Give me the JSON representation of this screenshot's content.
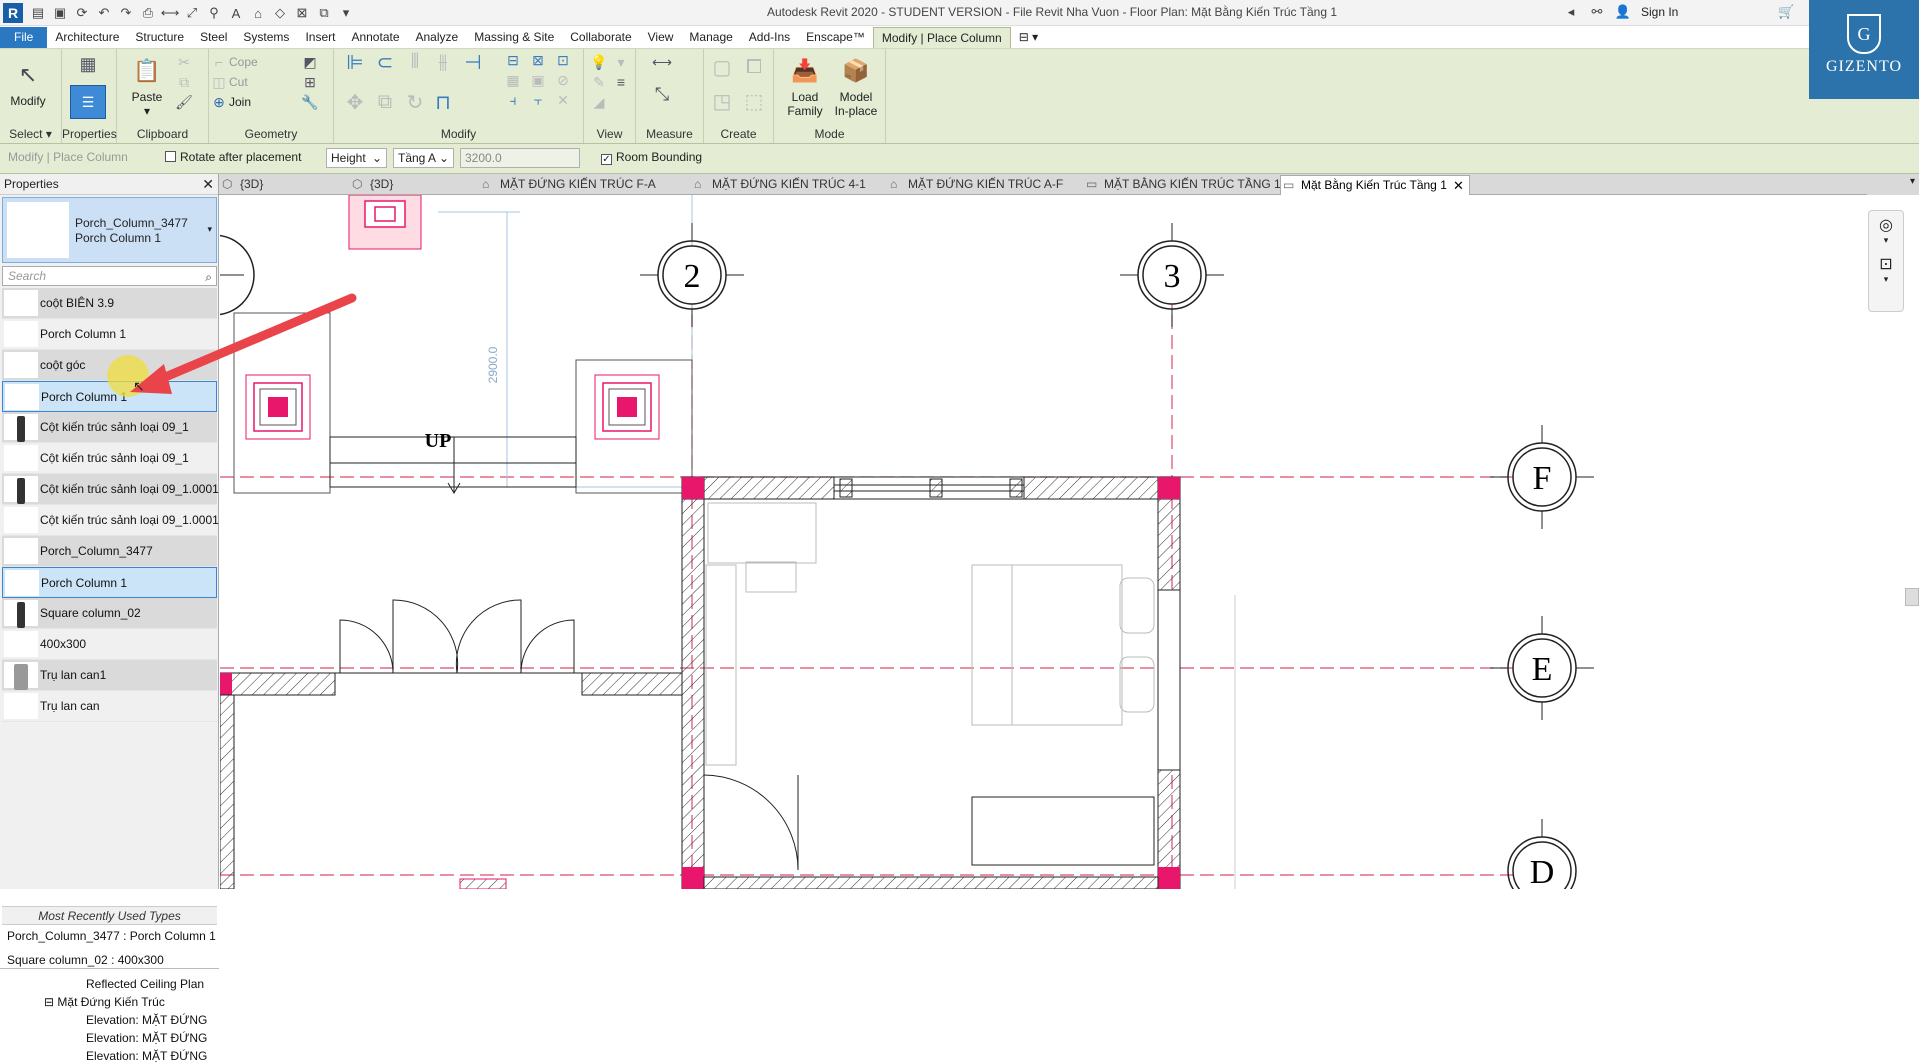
{
  "app": {
    "title": "Autodesk Revit 2020 - STUDENT VERSION - File Revit Nha Vuon - Floor Plan: Mặt Bằng Kiến Trúc Tầng 1",
    "sign_in": "Sign In",
    "logo": "R"
  },
  "menu": [
    "File",
    "Architecture",
    "Structure",
    "Steel",
    "Systems",
    "Insert",
    "Annotate",
    "Analyze",
    "Massing & Site",
    "Collaborate",
    "View",
    "Manage",
    "Add-Ins",
    "Enscape™",
    "Modify | Place Column"
  ],
  "ribbon": {
    "select_label": "Select",
    "properties_label": "Properties",
    "clipboard_label": "Clipboard",
    "geometry_label": "Geometry",
    "modify_label": "Modify",
    "view_label": "View",
    "measure_label": "Measure",
    "create_label": "Create",
    "mode_label": "Mode",
    "modify_btn": "Modify",
    "paste_btn": "Paste",
    "cope": "Cope",
    "cut": "Cut",
    "join": "Join",
    "load_family_1": "Load",
    "load_family_2": "Family",
    "model_inplace_1": "Model",
    "model_inplace_2": "In-place"
  },
  "options": {
    "context": "Modify | Place Column",
    "rotate": "Rotate after placement",
    "height_mode": "Height",
    "level": "Tầng A",
    "height_value": "3200.0",
    "room_bounding": "Room Bounding"
  },
  "view_tabs": [
    "{3D}",
    "{3D}",
    "MẶT ĐỨNG KIẾN TRÚC F-A",
    "MẶT ĐỨNG KIẾN TRÚC 4-1",
    "MẶT ĐỨNG KIẾN TRÚC A-F",
    "MẶT BẰNG KIẾN TRÚC TẦNG 1",
    "Mặt Bằng Kiến Trúc Tầng 1"
  ],
  "properties": {
    "header": "Properties",
    "type_family": "Porch_Column_3477",
    "type_name": "Porch Column 1",
    "search_placeholder": "Search",
    "types": [
      {
        "label": "coột BIÊN 3.9",
        "shaded": true,
        "glyph": "none"
      },
      {
        "label": "Porch Column 1",
        "shaded": false,
        "glyph": "none"
      },
      {
        "label": "coột góc",
        "shaded": true,
        "glyph": "none"
      },
      {
        "label": "Porch Column 1",
        "shaded": false,
        "glyph": "none",
        "selected": true
      },
      {
        "label": "Cột kiến trúc sảnh loại 09_1",
        "shaded": true,
        "glyph": "dark"
      },
      {
        "label": "Cột kiến trúc sảnh loại 09_1",
        "shaded": false,
        "glyph": "none"
      },
      {
        "label": "Cột kiến trúc sảnh loại 09_1.0001",
        "shaded": true,
        "glyph": "dark"
      },
      {
        "label": "Cột kiến trúc sảnh loại 09_1.0001",
        "shaded": false,
        "glyph": "none"
      },
      {
        "label": "Porch_Column_3477",
        "shaded": true,
        "glyph": "none"
      },
      {
        "label": "Porch Column 1",
        "shaded": false,
        "glyph": "none",
        "selected": true
      },
      {
        "label": "Square column_02",
        "shaded": true,
        "glyph": "dark"
      },
      {
        "label": "400x300",
        "shaded": false,
        "glyph": "none"
      },
      {
        "label": "Trụ lan can1",
        "shaded": true,
        "glyph": "light"
      },
      {
        "label": "Trụ lan can",
        "shaded": false,
        "glyph": "none"
      }
    ],
    "mru_header": "Most Recently Used Types",
    "mru": [
      "Porch_Column_3477 : Porch Column 1",
      "Square column_02 : 400x300"
    ]
  },
  "browser": {
    "items": [
      "Reflected Ceiling Plan",
      "Mặt Đứng Kiến Trúc",
      "Elevation: MẶT ĐỨNG",
      "Elevation: MẶT ĐỨNG",
      "Elevation: MẶT ĐỨNG"
    ]
  },
  "canvas": {
    "grid_2": "2",
    "grid_3": "3",
    "grid_F": "F",
    "grid_E": "E",
    "grid_D": "D",
    "stair_up": "UP",
    "dim_text": "2900.0"
  },
  "logo_text": "GIZENTO",
  "logo_mark": "G",
  "colors": {
    "ribbon": "#e4ecd4",
    "accent": "#2b78c2",
    "column_red": "#e8176b",
    "grid_red": "#d94c6a"
  }
}
